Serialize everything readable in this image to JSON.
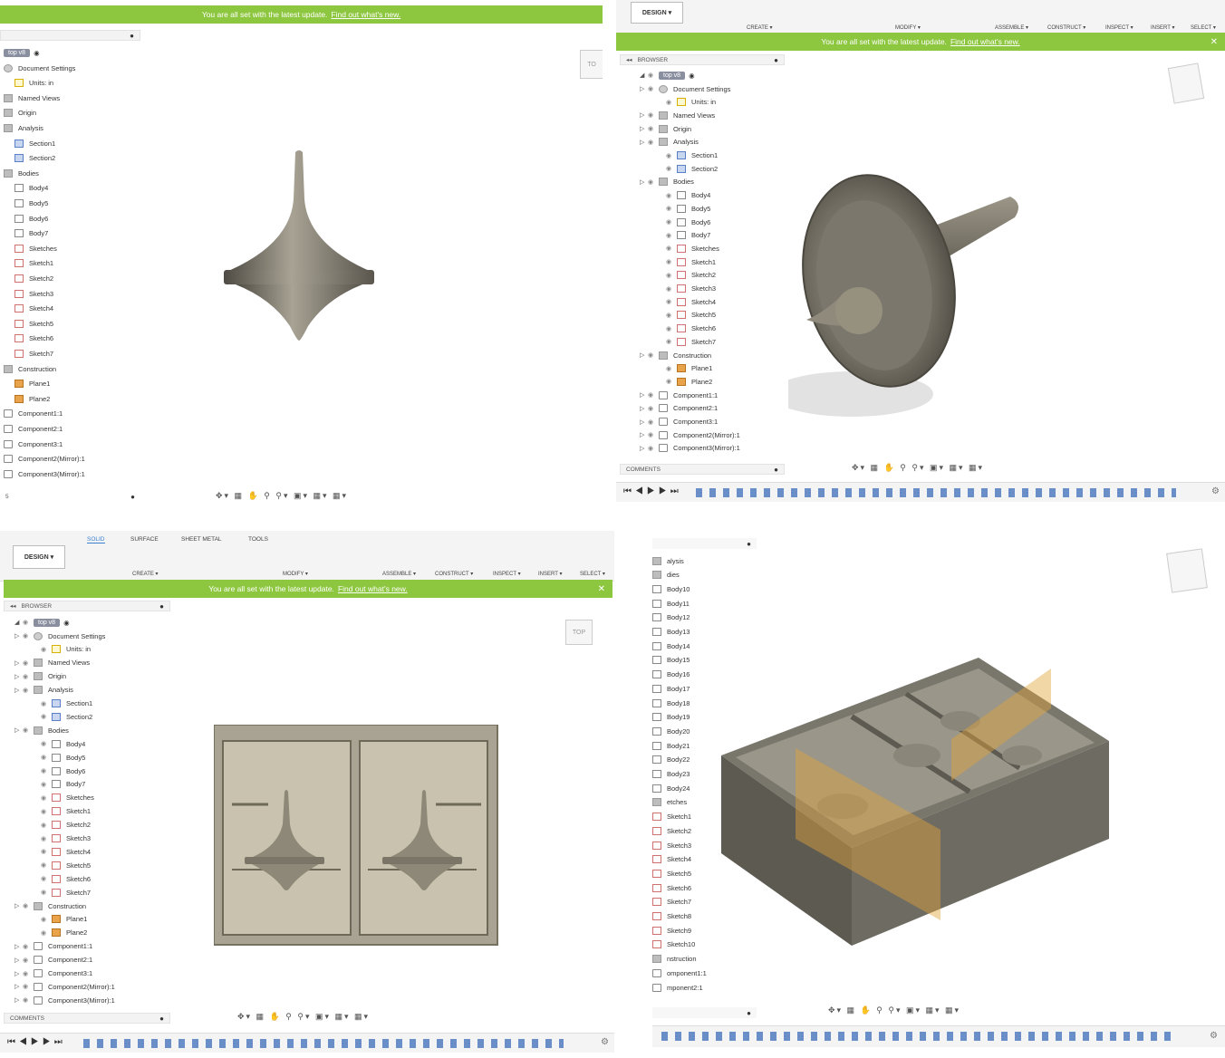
{
  "common": {
    "banner_text": "You are all set with the latest update.",
    "banner_link": "Find out what's new.",
    "design_label": "DESIGN ▾",
    "browser_label": "BROWSER",
    "comments_label": "COMMENTS",
    "top_label": "TOP",
    "top_label_partial": "TO",
    "version_label": "top v8",
    "toolbar_groups": [
      "CREATE ▾",
      "MODIFY ▾",
      "ASSEMBLE ▾",
      "CONSTRUCT ▾",
      "INSPECT ▾",
      "INSERT ▾",
      "SELECT ▾"
    ],
    "tabs": [
      "SOLID",
      "SURFACE",
      "SHEET METAL",
      "TOOLS"
    ]
  },
  "q1_tree": [
    "Document Settings",
    "Units: in",
    "Named Views",
    "Origin",
    "Analysis",
    "Section1",
    "Section2",
    "Bodies",
    "Body4",
    "Body5",
    "Body6",
    "Body7",
    "Sketches",
    "Sketch1",
    "Sketch2",
    "Sketch3",
    "Sketch4",
    "Sketch5",
    "Sketch6",
    "Sketch7",
    "Construction",
    "Plane1",
    "Plane2",
    "Component1:1",
    "Component2:1",
    "Component3:1",
    "Component2(Mirror):1",
    "Component3(Mirror):1"
  ],
  "q1_footer_char": "5",
  "q2_tree": [
    "Document Settings",
    "Units: in",
    "Named Views",
    "Origin",
    "Analysis",
    "Section1",
    "Section2",
    "Bodies",
    "Body4",
    "Body5",
    "Body6",
    "Body7",
    "Sketches",
    "Sketch1",
    "Sketch2",
    "Sketch3",
    "Sketch4",
    "Sketch5",
    "Sketch6",
    "Sketch7",
    "Construction",
    "Plane1",
    "Plane2",
    "Component1:1",
    "Component2:1",
    "Component3:1",
    "Component2(Mirror):1",
    "Component3(Mirror):1"
  ],
  "q3_tree": [
    "Document Settings",
    "Units: in",
    "Named Views",
    "Origin",
    "Analysis",
    "Section1",
    "Section2",
    "Bodies",
    "Body4",
    "Body5",
    "Body6",
    "Body7",
    "Sketches",
    "Sketch1",
    "Sketch2",
    "Sketch3",
    "Sketch4",
    "Sketch5",
    "Sketch6",
    "Sketch7",
    "Construction",
    "Plane1",
    "Plane2",
    "Component1:1",
    "Component2:1",
    "Component3:1",
    "Component2(Mirror):1",
    "Component3(Mirror):1"
  ],
  "q4_tree": [
    "alysis",
    "dies",
    "Body10",
    "Body11",
    "Body12",
    "Body13",
    "Body14",
    "Body15",
    "Body16",
    "Body17",
    "Body18",
    "Body19",
    "Body20",
    "Body21",
    "Body22",
    "Body23",
    "Body24",
    "etches",
    "Sketch1",
    "Sketch2",
    "Sketch3",
    "Sketch4",
    "Sketch5",
    "Sketch6",
    "Sketch7",
    "Sketch8",
    "Sketch9",
    "Sketch10",
    "nstruction",
    "omponent1:1",
    "mponent2:1"
  ]
}
